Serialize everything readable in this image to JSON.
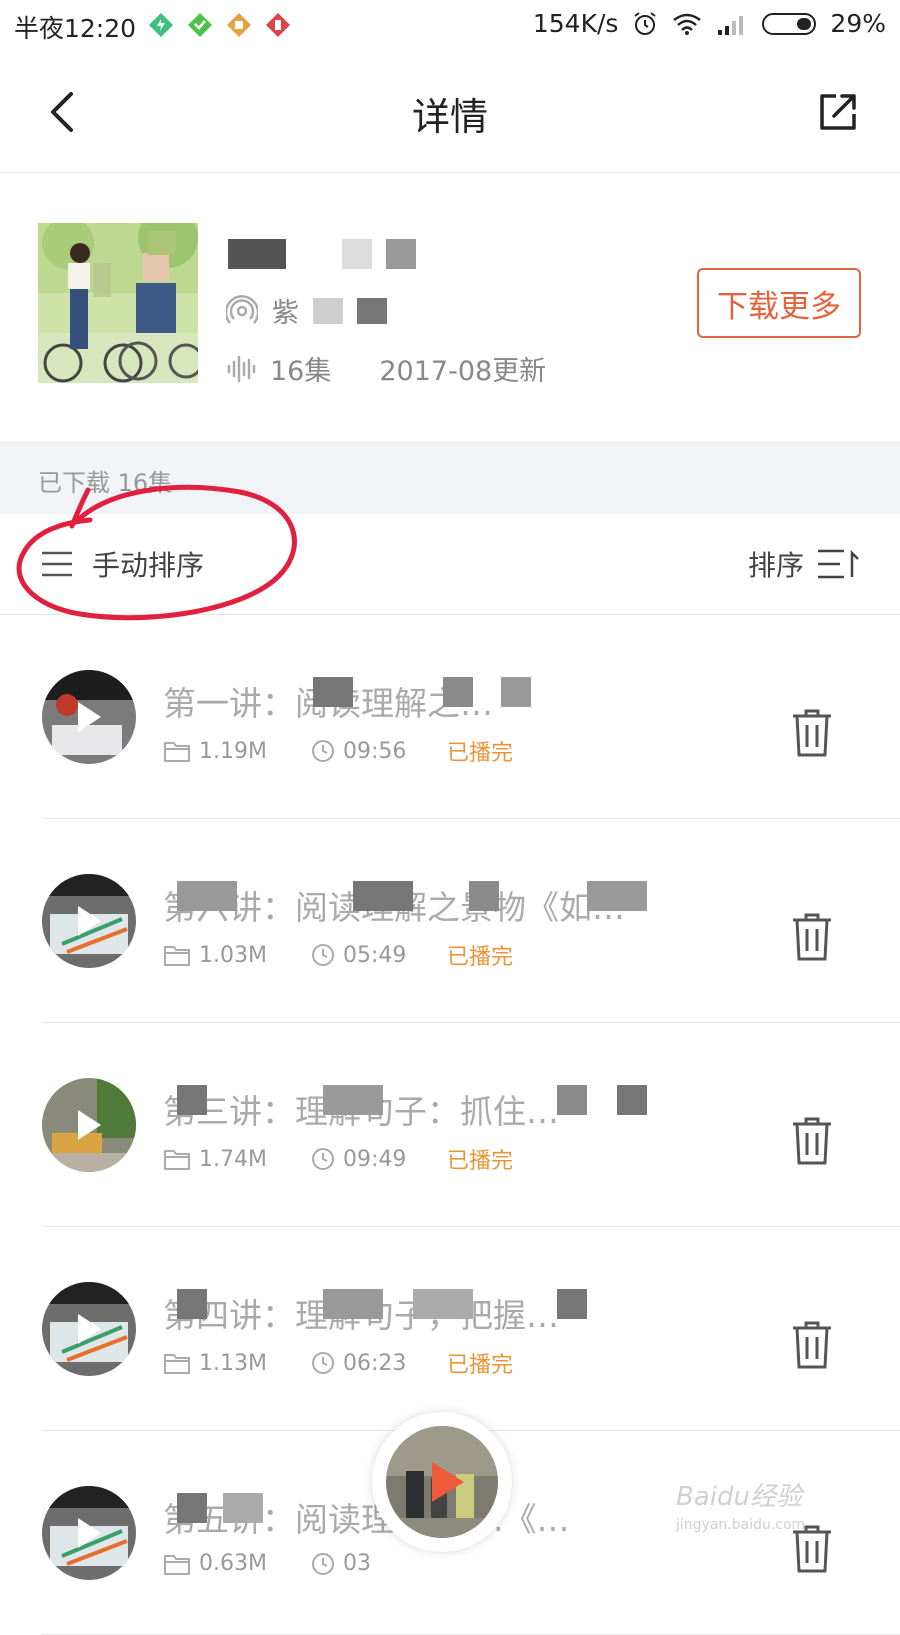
{
  "status_bar": {
    "time": "半夜12:20",
    "speed": "154K/s",
    "battery": "29%"
  },
  "header": {
    "title": "详情"
  },
  "album": {
    "anchor_prefix": "紫",
    "episode_count": "16集",
    "updated": "2017-08更新",
    "download_more": "下载更多"
  },
  "downloaded": {
    "count_label": "已下载 16集"
  },
  "sort_row": {
    "manual_sort": "手动排序",
    "sort": "排序"
  },
  "colors": {
    "accent": "#e0643f",
    "played": "#e8963a",
    "annotation": "#e0203f"
  },
  "episodes": [
    {
      "title": "第一讲：阅读理解之…",
      "size": "1.19M",
      "duration": "09:56",
      "status": "已播完"
    },
    {
      "title": "第六讲：阅读理解之景物《如…",
      "size": "1.03M",
      "duration": "05:49",
      "status": "已播完"
    },
    {
      "title": "第三讲：理解句子：抓住…",
      "size": "1.74M",
      "duration": "09:49",
      "status": "已播完"
    },
    {
      "title": "第四讲：理解句子，把握…",
      "size": "1.13M",
      "duration": "06:23",
      "status": "已播完"
    },
    {
      "title": "第五讲：阅读理解句子.《…",
      "size": "0.63M",
      "duration": "03",
      "status": ""
    }
  ],
  "watermark": {
    "brand": "Baidu经验",
    "site": "jingyan.baidu.com"
  }
}
